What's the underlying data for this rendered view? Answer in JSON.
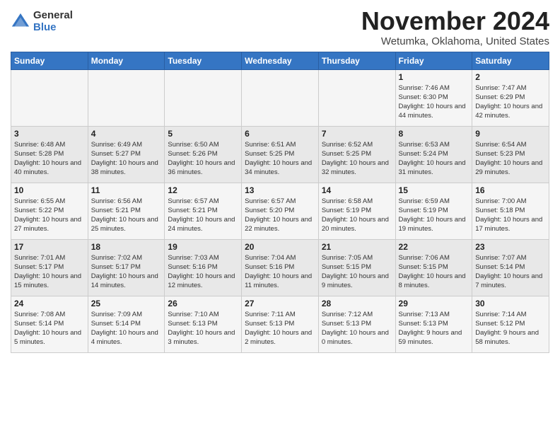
{
  "header": {
    "logo_general": "General",
    "logo_blue": "Blue",
    "month_title": "November 2024",
    "location": "Wetumka, Oklahoma, United States"
  },
  "days_of_week": [
    "Sunday",
    "Monday",
    "Tuesday",
    "Wednesday",
    "Thursday",
    "Friday",
    "Saturday"
  ],
  "weeks": [
    [
      {
        "day": "",
        "sunrise": "",
        "sunset": "",
        "daylight": ""
      },
      {
        "day": "",
        "sunrise": "",
        "sunset": "",
        "daylight": ""
      },
      {
        "day": "",
        "sunrise": "",
        "sunset": "",
        "daylight": ""
      },
      {
        "day": "",
        "sunrise": "",
        "sunset": "",
        "daylight": ""
      },
      {
        "day": "",
        "sunrise": "",
        "sunset": "",
        "daylight": ""
      },
      {
        "day": "1",
        "sunrise": "Sunrise: 7:46 AM",
        "sunset": "Sunset: 6:30 PM",
        "daylight": "Daylight: 10 hours and 44 minutes."
      },
      {
        "day": "2",
        "sunrise": "Sunrise: 7:47 AM",
        "sunset": "Sunset: 6:29 PM",
        "daylight": "Daylight: 10 hours and 42 minutes."
      }
    ],
    [
      {
        "day": "3",
        "sunrise": "Sunrise: 6:48 AM",
        "sunset": "Sunset: 5:28 PM",
        "daylight": "Daylight: 10 hours and 40 minutes."
      },
      {
        "day": "4",
        "sunrise": "Sunrise: 6:49 AM",
        "sunset": "Sunset: 5:27 PM",
        "daylight": "Daylight: 10 hours and 38 minutes."
      },
      {
        "day": "5",
        "sunrise": "Sunrise: 6:50 AM",
        "sunset": "Sunset: 5:26 PM",
        "daylight": "Daylight: 10 hours and 36 minutes."
      },
      {
        "day": "6",
        "sunrise": "Sunrise: 6:51 AM",
        "sunset": "Sunset: 5:25 PM",
        "daylight": "Daylight: 10 hours and 34 minutes."
      },
      {
        "day": "7",
        "sunrise": "Sunrise: 6:52 AM",
        "sunset": "Sunset: 5:25 PM",
        "daylight": "Daylight: 10 hours and 32 minutes."
      },
      {
        "day": "8",
        "sunrise": "Sunrise: 6:53 AM",
        "sunset": "Sunset: 5:24 PM",
        "daylight": "Daylight: 10 hours and 31 minutes."
      },
      {
        "day": "9",
        "sunrise": "Sunrise: 6:54 AM",
        "sunset": "Sunset: 5:23 PM",
        "daylight": "Daylight: 10 hours and 29 minutes."
      }
    ],
    [
      {
        "day": "10",
        "sunrise": "Sunrise: 6:55 AM",
        "sunset": "Sunset: 5:22 PM",
        "daylight": "Daylight: 10 hours and 27 minutes."
      },
      {
        "day": "11",
        "sunrise": "Sunrise: 6:56 AM",
        "sunset": "Sunset: 5:21 PM",
        "daylight": "Daylight: 10 hours and 25 minutes."
      },
      {
        "day": "12",
        "sunrise": "Sunrise: 6:57 AM",
        "sunset": "Sunset: 5:21 PM",
        "daylight": "Daylight: 10 hours and 24 minutes."
      },
      {
        "day": "13",
        "sunrise": "Sunrise: 6:57 AM",
        "sunset": "Sunset: 5:20 PM",
        "daylight": "Daylight: 10 hours and 22 minutes."
      },
      {
        "day": "14",
        "sunrise": "Sunrise: 6:58 AM",
        "sunset": "Sunset: 5:19 PM",
        "daylight": "Daylight: 10 hours and 20 minutes."
      },
      {
        "day": "15",
        "sunrise": "Sunrise: 6:59 AM",
        "sunset": "Sunset: 5:19 PM",
        "daylight": "Daylight: 10 hours and 19 minutes."
      },
      {
        "day": "16",
        "sunrise": "Sunrise: 7:00 AM",
        "sunset": "Sunset: 5:18 PM",
        "daylight": "Daylight: 10 hours and 17 minutes."
      }
    ],
    [
      {
        "day": "17",
        "sunrise": "Sunrise: 7:01 AM",
        "sunset": "Sunset: 5:17 PM",
        "daylight": "Daylight: 10 hours and 15 minutes."
      },
      {
        "day": "18",
        "sunrise": "Sunrise: 7:02 AM",
        "sunset": "Sunset: 5:17 PM",
        "daylight": "Daylight: 10 hours and 14 minutes."
      },
      {
        "day": "19",
        "sunrise": "Sunrise: 7:03 AM",
        "sunset": "Sunset: 5:16 PM",
        "daylight": "Daylight: 10 hours and 12 minutes."
      },
      {
        "day": "20",
        "sunrise": "Sunrise: 7:04 AM",
        "sunset": "Sunset: 5:16 PM",
        "daylight": "Daylight: 10 hours and 11 minutes."
      },
      {
        "day": "21",
        "sunrise": "Sunrise: 7:05 AM",
        "sunset": "Sunset: 5:15 PM",
        "daylight": "Daylight: 10 hours and 9 minutes."
      },
      {
        "day": "22",
        "sunrise": "Sunrise: 7:06 AM",
        "sunset": "Sunset: 5:15 PM",
        "daylight": "Daylight: 10 hours and 8 minutes."
      },
      {
        "day": "23",
        "sunrise": "Sunrise: 7:07 AM",
        "sunset": "Sunset: 5:14 PM",
        "daylight": "Daylight: 10 hours and 7 minutes."
      }
    ],
    [
      {
        "day": "24",
        "sunrise": "Sunrise: 7:08 AM",
        "sunset": "Sunset: 5:14 PM",
        "daylight": "Daylight: 10 hours and 5 minutes."
      },
      {
        "day": "25",
        "sunrise": "Sunrise: 7:09 AM",
        "sunset": "Sunset: 5:14 PM",
        "daylight": "Daylight: 10 hours and 4 minutes."
      },
      {
        "day": "26",
        "sunrise": "Sunrise: 7:10 AM",
        "sunset": "Sunset: 5:13 PM",
        "daylight": "Daylight: 10 hours and 3 minutes."
      },
      {
        "day": "27",
        "sunrise": "Sunrise: 7:11 AM",
        "sunset": "Sunset: 5:13 PM",
        "daylight": "Daylight: 10 hours and 2 minutes."
      },
      {
        "day": "28",
        "sunrise": "Sunrise: 7:12 AM",
        "sunset": "Sunset: 5:13 PM",
        "daylight": "Daylight: 10 hours and 0 minutes."
      },
      {
        "day": "29",
        "sunrise": "Sunrise: 7:13 AM",
        "sunset": "Sunset: 5:13 PM",
        "daylight": "Daylight: 9 hours and 59 minutes."
      },
      {
        "day": "30",
        "sunrise": "Sunrise: 7:14 AM",
        "sunset": "Sunset: 5:12 PM",
        "daylight": "Daylight: 9 hours and 58 minutes."
      }
    ]
  ]
}
